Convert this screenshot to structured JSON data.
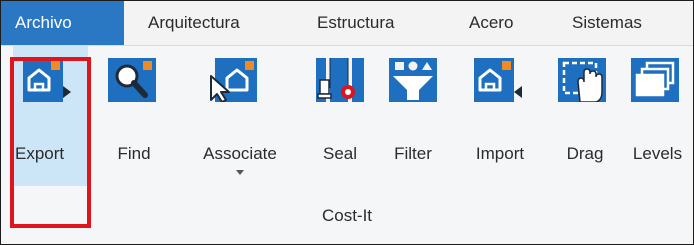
{
  "ribbon": {
    "tabs": [
      {
        "label": "Archivo",
        "active": true
      },
      {
        "label": "Arquitectura"
      },
      {
        "label": "Estructura"
      },
      {
        "label": "Acero"
      },
      {
        "label": "Sistemas"
      }
    ],
    "tools": [
      {
        "label": "Export",
        "icon": "export-icon",
        "selected": true
      },
      {
        "label": "Find",
        "icon": "find-icon"
      },
      {
        "label": "Associate",
        "icon": "associate-icon",
        "has_dropdown": true
      },
      {
        "label": "Seal",
        "icon": "seal-icon"
      },
      {
        "label": "Filter",
        "icon": "filter-icon"
      },
      {
        "label": "Import",
        "icon": "import-icon"
      },
      {
        "label": "Drag",
        "icon": "drag-icon"
      },
      {
        "label": "Levels",
        "icon": "levels-icon"
      }
    ],
    "panel_title": "Cost-It"
  },
  "colors": {
    "accent": "#2a78c4",
    "icon_blue": "#1e6fc0",
    "icon_orange": "#f08a24",
    "highlight_red": "#e0141c",
    "selected_bg": "#cde6f7"
  }
}
